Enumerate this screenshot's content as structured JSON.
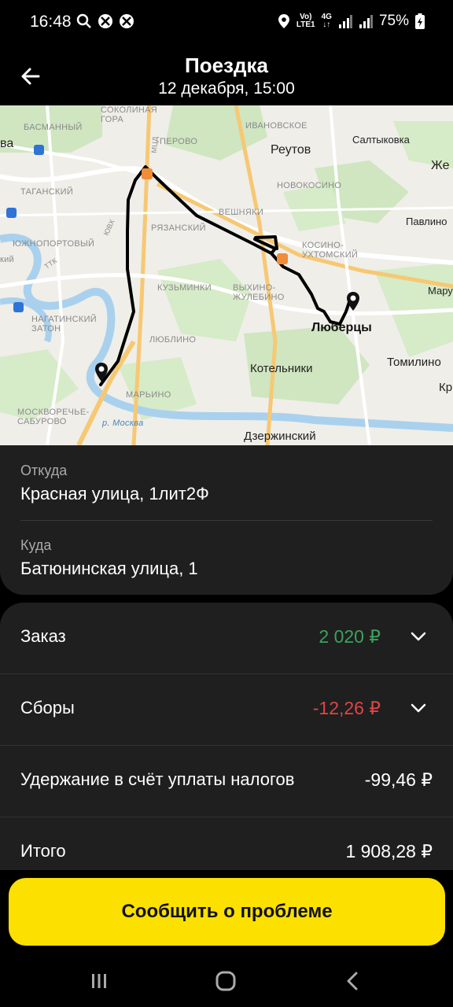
{
  "status_bar": {
    "time": "16:48",
    "network_top": "Vo)",
    "network_bottom": "LTE1",
    "network_gen": "4G",
    "battery": "75%"
  },
  "header": {
    "title": "Поездка",
    "subtitle": "12 декабря, 15:00"
  },
  "map": {
    "labels": {
      "sokolnaya_gora": "СОКОЛИНАЯ\nГОРА",
      "basmanny": "БАСМАННЫЙ",
      "ivanovskoe": "ИВАНОВСКОЕ",
      "saltykovka": "Салтыковка",
      "reutov": "Реутов",
      "perovo": "ПЕРОВО",
      "novokosino": "НОВОКОСИНО",
      "tagansky": "ТАГАНСКИЙ",
      "veshnyaki": "ВЕШНЯКИ",
      "pavlino": "Павлино",
      "ryazansky": "РЯЗАНСКИЙ",
      "yuzhnoportovy": "ЮЖНОПОРТОВЫЙ",
      "kosino_ukhtomsky": "КОСИНО-\nУХТОМСКИЙ",
      "kuzminki": "КУЗЬМИНКИ",
      "vykhino": "ВЫХИНО-\nЖУЛЕБИНО",
      "nagatinsky": "НАГАТИНСКИЙ\nЗАТОН",
      "lyubertsy": "Люберцы",
      "lyublino": "ЛЮБЛИНО",
      "tomilino": "Томилино",
      "kotelniki": "Котельники",
      "maryino": "МАРЬИНО",
      "moskvorechye": "МОСКВОРЕЧЬЕ-\nСАБУРОВО",
      "river": "р. Москва",
      "dzerzhinsky": "Дзержинский",
      "mcd": "МЦД",
      "ttk": "ТТК",
      "yuv": "ЮВХ",
      "edge_va": "ва",
      "edge_zhe": "Же",
      "edge_mary": "Мару",
      "edge_kr": "Кр",
      "edge_ky": "кий"
    }
  },
  "route": {
    "from_label": "Откуда",
    "from_value": "Красная улица, 1лит2Ф",
    "to_label": "Куда",
    "to_value": "Батюнинская улица, 1"
  },
  "finance": {
    "order_label": "Заказ",
    "order_value": "2 020 ₽",
    "fees_label": "Сборы",
    "fees_value": "-12,26 ₽",
    "tax_label": "Удержание в счёт уплаты налогов",
    "tax_value": "-99,46 ₽",
    "total_label": "Итого",
    "total_value": "1 908,28 ₽"
  },
  "cta": {
    "label": "Сообщить о проблеме"
  },
  "colors": {
    "accent_yellow": "#fbe000",
    "positive_green": "#3aa35c",
    "negative_red": "#e04545"
  },
  "icons": [
    "back-arrow-icon",
    "search-icon",
    "location-icon",
    "signal-icon",
    "battery-icon",
    "chevron-down-icon",
    "recent-apps-icon",
    "home-icon",
    "back-nav-icon",
    "pin-icon"
  ]
}
